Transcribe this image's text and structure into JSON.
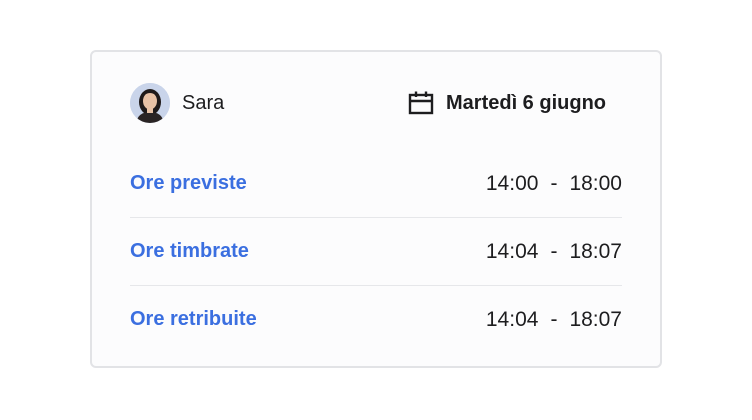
{
  "user": {
    "name": "Sara",
    "avatar_icon": "avatar-photo"
  },
  "date": {
    "icon": "calendar-icon",
    "label": "Martedì 6 giugno"
  },
  "rows": [
    {
      "label": "Ore previste",
      "start": "14:00",
      "separator": "-",
      "end": "18:00"
    },
    {
      "label": "Ore timbrate",
      "start": "14:04",
      "separator": "-",
      "end": "18:07"
    },
    {
      "label": "Ore retribuite",
      "start": "14:04",
      "separator": "-",
      "end": "18:07"
    }
  ],
  "colors": {
    "accent": "#3b6fe0",
    "text": "#1d1d1f",
    "border": "#e2e3e6"
  }
}
